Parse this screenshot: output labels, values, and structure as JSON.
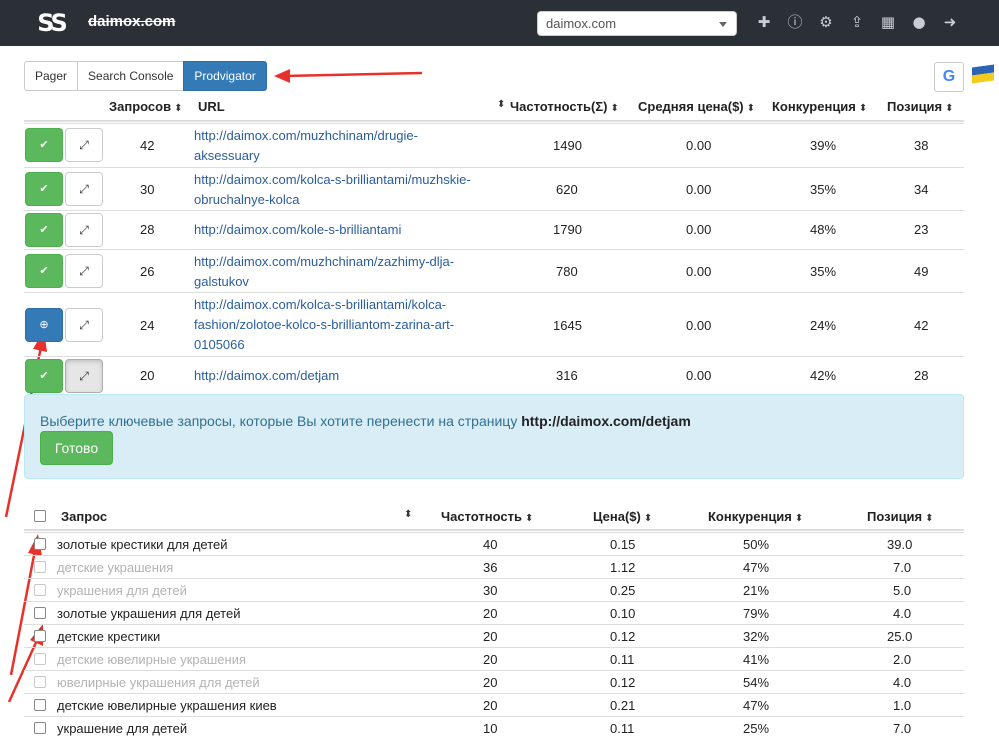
{
  "header": {
    "logo_text": "SS",
    "site_name": "daimox.com",
    "site_select_value": "daimox.com",
    "icons": [
      "plus-icon",
      "info-icon",
      "settings-icon",
      "upload-icon",
      "grid-icon",
      "user-icon",
      "logout-icon"
    ]
  },
  "tabs": [
    {
      "label": "Pager"
    },
    {
      "label": "Search Console"
    },
    {
      "label": "Prodvigator"
    }
  ],
  "search_engine_letter": "G",
  "url_table": {
    "headers": {
      "requests": "Запросов",
      "url": "URL",
      "frequency": "Частотность(Σ)",
      "avg_price": "Средняя цена($)",
      "competition": "Конкуренция",
      "position": "Позиция"
    },
    "rows": [
      {
        "requests": "42",
        "url": "http://daimox.com/muzhchinam/drugie-aksessuary",
        "frequency": "1490",
        "avg_price": "0.00",
        "competition": "39%",
        "position": "38",
        "url_lines": [
          "http://daimox.com/muzhchinam/drugie-",
          "aksessuary"
        ]
      },
      {
        "requests": "30",
        "url": "http://daimox.com/kolca-s-brilliantami/muzhskie-obruchalnye-kolca",
        "frequency": "620",
        "avg_price": "0.00",
        "competition": "35%",
        "position": "34",
        "url_lines": [
          "http://daimox.com/kolca-s-brilliantami/muzhskie-",
          "obruchalnye-kolca"
        ]
      },
      {
        "requests": "28",
        "url": "http://daimox.com/kole-s-brilliantami",
        "frequency": "1790",
        "avg_price": "0.00",
        "competition": "48%",
        "position": "23",
        "url_lines": [
          "http://daimox.com/kole-s-brilliantami"
        ]
      },
      {
        "requests": "26",
        "url": "http://daimox.com/muzhchinam/zazhimy-dlja-galstukov",
        "frequency": "780",
        "avg_price": "0.00",
        "competition": "35%",
        "position": "49",
        "url_lines": [
          "http://daimox.com/muzhchinam/zazhimy-dlja-",
          "galstukov"
        ]
      },
      {
        "requests": "24",
        "url": "http://daimox.com/kolca-s-brilliantami/kolca-fashion/zolotoe-kolco-s-brilliantom-zarina-art-0105066",
        "frequency": "1645",
        "avg_price": "0.00",
        "competition": "24%",
        "position": "42",
        "url_lines": [
          "http://daimox.com/kolca-s-brilliantami/kolca-",
          "fashion/zolotoe-kolco-s-brilliantom-zarina-art-",
          "0105066"
        ]
      },
      {
        "requests": "20",
        "url": "http://daimox.com/detjam",
        "frequency": "316",
        "avg_price": "0.00",
        "competition": "42%",
        "position": "28",
        "url_lines": [
          "http://daimox.com/detjam"
        ]
      }
    ]
  },
  "info_panel": {
    "text": "Выберите ключевые запросы, которые Вы хотите перенести на страницу",
    "target_url": "http://daimox.com/detjam",
    "done_label": "Готово"
  },
  "keyword_table": {
    "headers": {
      "query": "Запрос",
      "frequency": "Частотность",
      "price": "Цена($)",
      "competition": "Конкуренция",
      "position": "Позиция"
    },
    "rows": [
      {
        "query": "золотые крестики для детей",
        "frequency": "40",
        "price": "0.15",
        "competition": "50%",
        "position": "39.0",
        "muted": false
      },
      {
        "query": "детские украшения",
        "frequency": "36",
        "price": "1.12",
        "competition": "47%",
        "position": "7.0",
        "muted": true
      },
      {
        "query": "украшения для детей",
        "frequency": "30",
        "price": "0.25",
        "competition": "21%",
        "position": "5.0",
        "muted": true
      },
      {
        "query": "золотые украшения для детей",
        "frequency": "20",
        "price": "0.10",
        "competition": "79%",
        "position": "4.0",
        "muted": false
      },
      {
        "query": "детские крестики",
        "frequency": "20",
        "price": "0.12",
        "competition": "32%",
        "position": "25.0",
        "muted": false
      },
      {
        "query": "детские ювелирные украшения",
        "frequency": "20",
        "price": "0.11",
        "competition": "41%",
        "position": "2.0",
        "muted": true
      },
      {
        "query": "ювелирные украшения для детей",
        "frequency": "20",
        "price": "0.12",
        "competition": "54%",
        "position": "4.0",
        "muted": true
      },
      {
        "query": "детские ювелирные украшения киев",
        "frequency": "20",
        "price": "0.21",
        "competition": "47%",
        "position": "1.0",
        "muted": false
      },
      {
        "query": "украшение для детей",
        "frequency": "10",
        "price": "0.11",
        "competition": "25%",
        "position": "7.0",
        "muted": false
      }
    ]
  },
  "colors": {
    "topbar": "#2b2f36",
    "primary": "#337ab7",
    "success": "#5cb85c",
    "link": "#2a5d9e",
    "info_bg": "#d9edf7",
    "annotation_arrow": "#e8312a"
  }
}
